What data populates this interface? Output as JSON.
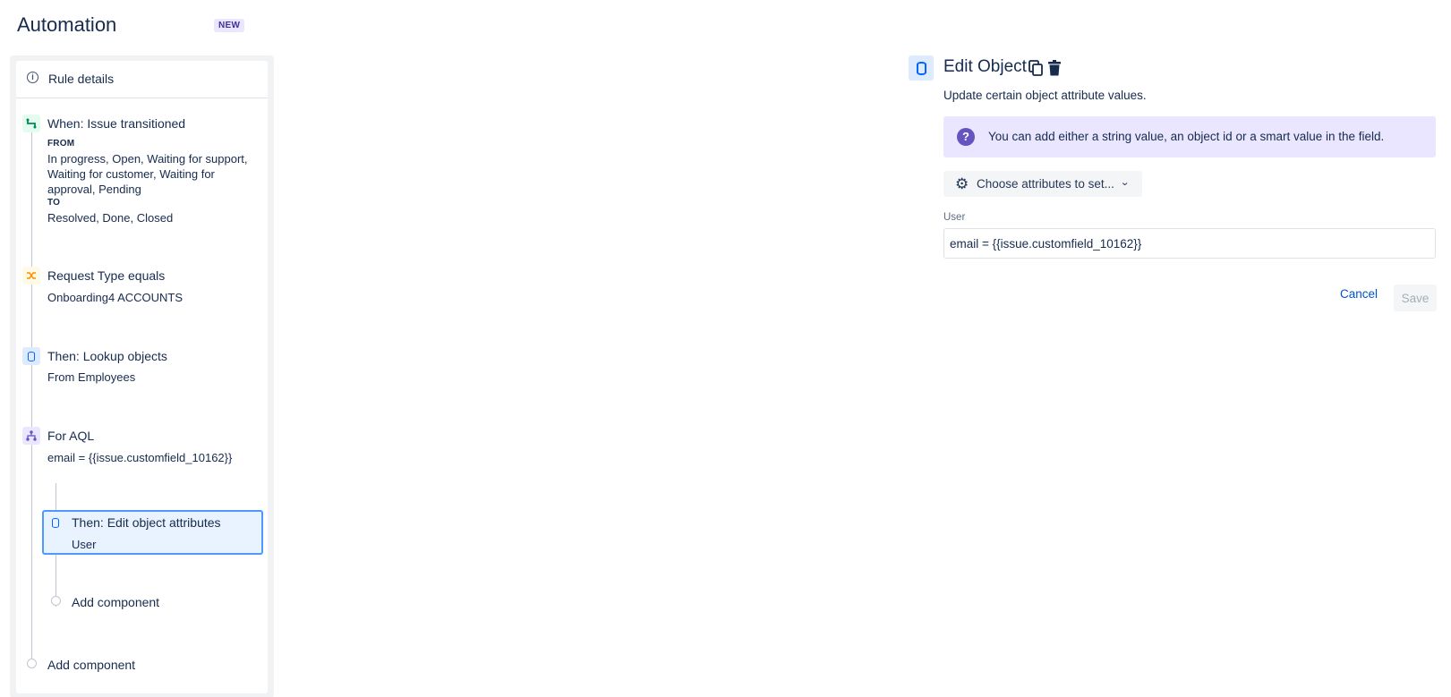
{
  "header": {
    "title": "Automation",
    "badge": "NEW"
  },
  "sidebar": {
    "rule_details": "Rule details",
    "trigger": {
      "title": "When: Issue transitioned",
      "from_label": "FROM",
      "from_value": "In progress, Open, Waiting for support, Waiting for customer, Waiting for approval, Pending",
      "to_label": "TO",
      "to_value": "Resolved, Done, Closed"
    },
    "condition": {
      "title": "Request Type equals",
      "value": "Onboarding4 ACCOUNTS"
    },
    "lookup": {
      "title": "Then: Lookup objects",
      "value": "From Employees"
    },
    "branch": {
      "title": "For AQL",
      "value": "email = {{issue.customfield_10162}}"
    },
    "edit_action": {
      "title": "Then: Edit object attributes",
      "value": "User"
    },
    "add_component_inner": "Add component",
    "add_component_outer": "Add component"
  },
  "panel": {
    "title": "Edit Object",
    "description": "Update certain object attribute values.",
    "info": "You can add either a string value, an object id or a smart value in the field.",
    "choose_button": "Choose attributes to set...",
    "field_label": "User",
    "field_value": "email = {{issue.customfield_10162}}",
    "cancel": "Cancel",
    "save": "Save"
  },
  "colors": {
    "accent": "#0052cc",
    "selected_border": "#4c9aff",
    "selected_bg": "#e9f2ff",
    "info_bg": "#eae6ff",
    "info_icon": "#6554c0"
  },
  "icons": {
    "rule_details": "info-icon",
    "trigger": "transition-icon",
    "condition": "shuffle-icon",
    "lookup": "database-icon",
    "branch": "branch-icon",
    "edit_action": "database-icon",
    "panel": "database-icon",
    "copy": "copy-icon",
    "delete": "trash-icon",
    "info": "question-icon",
    "settings": "gear-icon",
    "dropdown": "chevron-down-icon"
  }
}
